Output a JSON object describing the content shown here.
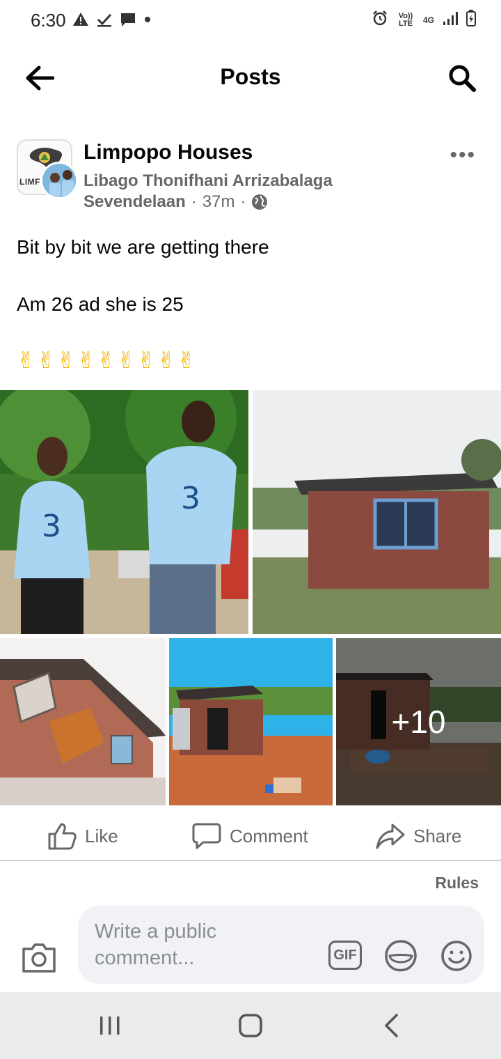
{
  "status_bar": {
    "time": "6:30",
    "left_icons": [
      "warning-icon",
      "check-download-icon",
      "message-icon",
      "dot-icon"
    ],
    "right_icons": [
      "alarm-icon",
      "volte-icon",
      "4g-icon",
      "signal-icon",
      "battery-icon"
    ],
    "volte_label": "Vo)) LTE",
    "network_label": "4G"
  },
  "app_bar": {
    "title": "Posts",
    "back_icon": "arrow-left-icon",
    "search_icon": "search-icon"
  },
  "post": {
    "group_name": "Limpopo Houses",
    "group_logo_text": "LIMF HOU",
    "author_name": "Libago Thonifhani Arrizabalaga",
    "location": "Sevendelaan",
    "time_ago": "37m",
    "separator": "·",
    "privacy_icon": "globe-icon",
    "more_label": "•••",
    "text_line_1": "Bit by bit we are getting there",
    "text_line_2": "Am 26 ad she is 25",
    "emojis": "✌✌✌✌✌✌✌✌✌",
    "photos": [
      {
        "subject": "couple-in-matching-jerseys"
      },
      {
        "subject": "brick-house-with-window"
      },
      {
        "subject": "brick-house-with-wooden-door"
      },
      {
        "subject": "small-brick-room-with-door"
      },
      {
        "subject": "brick-house-foundation"
      }
    ],
    "more_photos_label": "+10"
  },
  "actions": {
    "like": "Like",
    "comment": "Comment",
    "share": "Share"
  },
  "rules_label": "Rules",
  "composer": {
    "placeholder": "Write a public comment...",
    "gif_label": "GIF"
  },
  "colors": {
    "text_primary": "#050505",
    "text_secondary": "#65676b",
    "composer_bg": "#f0f2f5",
    "nav_bg": "#eaeceb"
  }
}
